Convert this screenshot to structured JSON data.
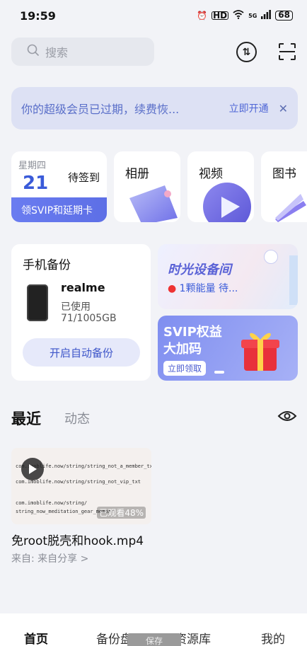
{
  "status_bar": {
    "time": "19:59",
    "network": "5G",
    "battery": "68",
    "hd": "HD"
  },
  "search": {
    "placeholder": "搜索"
  },
  "banner": {
    "text": "你的超级会员已过期，续费恢...",
    "action": "立即开通"
  },
  "sign_card": {
    "weekday": "星期四",
    "day": "21",
    "status": "待签到",
    "footer": "领SVIP和延期卡"
  },
  "tiles": [
    {
      "label": "相册"
    },
    {
      "label": "视频"
    },
    {
      "label": "图书"
    }
  ],
  "backup": {
    "title": "手机备份",
    "device_name": "realme",
    "used_label": "已使用",
    "used_value": "71/1005GB",
    "button": "开启自动备份"
  },
  "promo_time": {
    "title": "时光设备间",
    "subtitle": "1颗能量 待..."
  },
  "promo_svip": {
    "title_line1": "SVIP权益",
    "title_line2": "大加码",
    "button": "立即领取"
  },
  "recent": {
    "tab_recent": "最近",
    "tab_feed": "动态",
    "file": {
      "name": "免root脱壳和hook.mp4",
      "source": "来自: 来自分享 >",
      "progress": "已观看48%",
      "thumb_lines": [
        "com.imoblife.now/string/string_not_a_member_txt",
        "com.imoblife.now/string/string_not_vip_txt",
        "com.imoblife.now/string/",
        "string_now_meditation_gear_member"
      ]
    }
  },
  "bottom_nav": {
    "home": "首页",
    "backup": "备份盘",
    "resources": "资源库",
    "mine": "我的"
  },
  "toast": "保存",
  "colors": {
    "accent": "#3a5bd9",
    "banner_bg": "#dde1f4",
    "page_bg": "#f2f3f7"
  }
}
